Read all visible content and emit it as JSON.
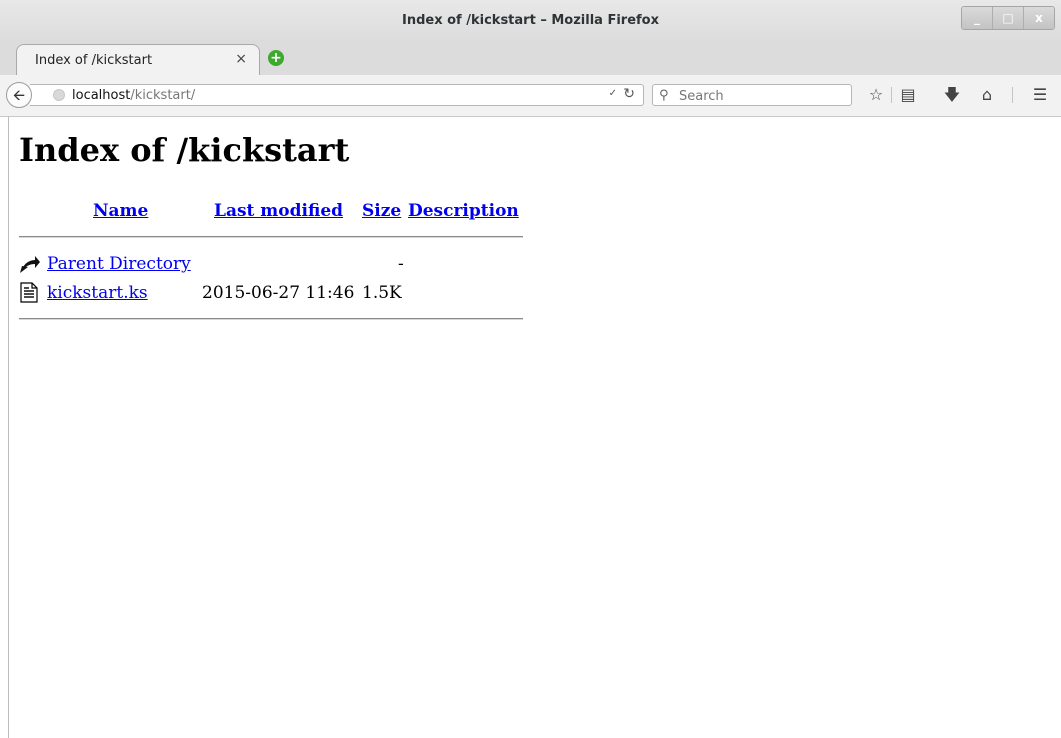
{
  "window": {
    "title": "Index of /kickstart – Mozilla Firefox",
    "buttons": {
      "minimize": "_",
      "maximize": "□",
      "close": "x"
    }
  },
  "tab": {
    "label": "Index of /kickstart",
    "close": "×",
    "new_tab": "+"
  },
  "navbar": {
    "url_host": "localhost",
    "url_path": "/kickstart/",
    "search_placeholder": "Search"
  },
  "page": {
    "heading": "Index of /kickstart",
    "columns": {
      "name": "Name",
      "last_modified": "Last modified",
      "size": "Size",
      "description": "Description"
    },
    "rows": [
      {
        "name": "Parent Directory",
        "last_modified": "",
        "size": "-",
        "description": "",
        "icon": "back-icon"
      },
      {
        "name": "kickstart.ks",
        "last_modified": "2015-06-27 11:46",
        "size": "1.5K",
        "description": "",
        "icon": "text-file-icon"
      }
    ]
  }
}
